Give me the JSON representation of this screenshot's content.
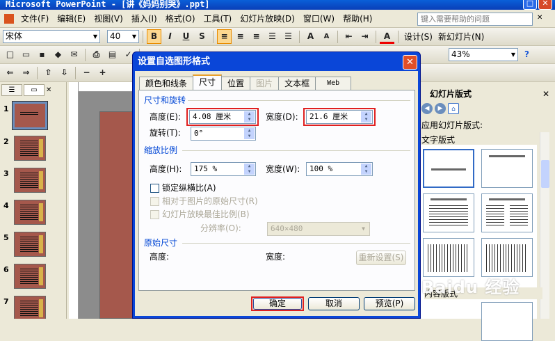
{
  "app": {
    "title": "Microsoft PowerPoint - [讲《妈妈别哭》.ppt]"
  },
  "menu": [
    "文件(F)",
    "编辑(E)",
    "视图(V)",
    "插入(I)",
    "格式(O)",
    "工具(T)",
    "幻灯片放映(D)",
    "窗口(W)",
    "帮助(H)"
  ],
  "help_placeholder": "键入需要帮助的问题",
  "toolbar": {
    "font_name": "宋体",
    "font_size": "40",
    "bold": "B",
    "italic": "I",
    "underline": "U",
    "shadow": "S",
    "design_label": "设计(S)",
    "new_slide_label": "新幻灯片(N)",
    "zoom": "43%"
  },
  "slides": [
    "1",
    "2",
    "3",
    "4",
    "5",
    "6",
    "7"
  ],
  "task_pane": {
    "title": "幻灯片版式",
    "apply_label": "应用幻灯片版式:",
    "text_layouts": "文字版式",
    "content_layouts": "内容版式"
  },
  "watermark": "Baidu 经验",
  "dialog": {
    "title": "设置自选图形格式",
    "tabs": [
      {
        "label": "颜色和线条",
        "state": "normal"
      },
      {
        "label": "尺寸",
        "state": "active"
      },
      {
        "label": "位置",
        "state": "normal"
      },
      {
        "label": "图片",
        "state": "disabled"
      },
      {
        "label": "文本框",
        "state": "normal"
      },
      {
        "label": "Web",
        "state": "normal"
      }
    ],
    "size_rotate_group": "尺寸和旋转",
    "height_label": "高度(E):",
    "height_value": "4.08 厘米",
    "width_label": "宽度(D):",
    "width_value": "21.6 厘米",
    "rotate_label": "旋转(T):",
    "rotate_value": "0°",
    "scale_group": "缩放比例",
    "scale_height_label": "高度(H):",
    "scale_height_value": "175 %",
    "scale_width_label": "宽度(W):",
    "scale_width_value": "100 %",
    "lock_aspect": "锁定纵横比(A)",
    "relative_original": "相对于图片的原始尺寸(R)",
    "best_scale": "幻灯片放映最佳比例(B)",
    "resolution_label": "分辨率(O):",
    "resolution_value": "640×480",
    "original_group": "原始尺寸",
    "orig_height_label": "高度:",
    "orig_width_label": "宽度:",
    "reset_button": "重新设置(S)",
    "ok": "确定",
    "cancel": "取消",
    "preview": "预览(P)"
  }
}
